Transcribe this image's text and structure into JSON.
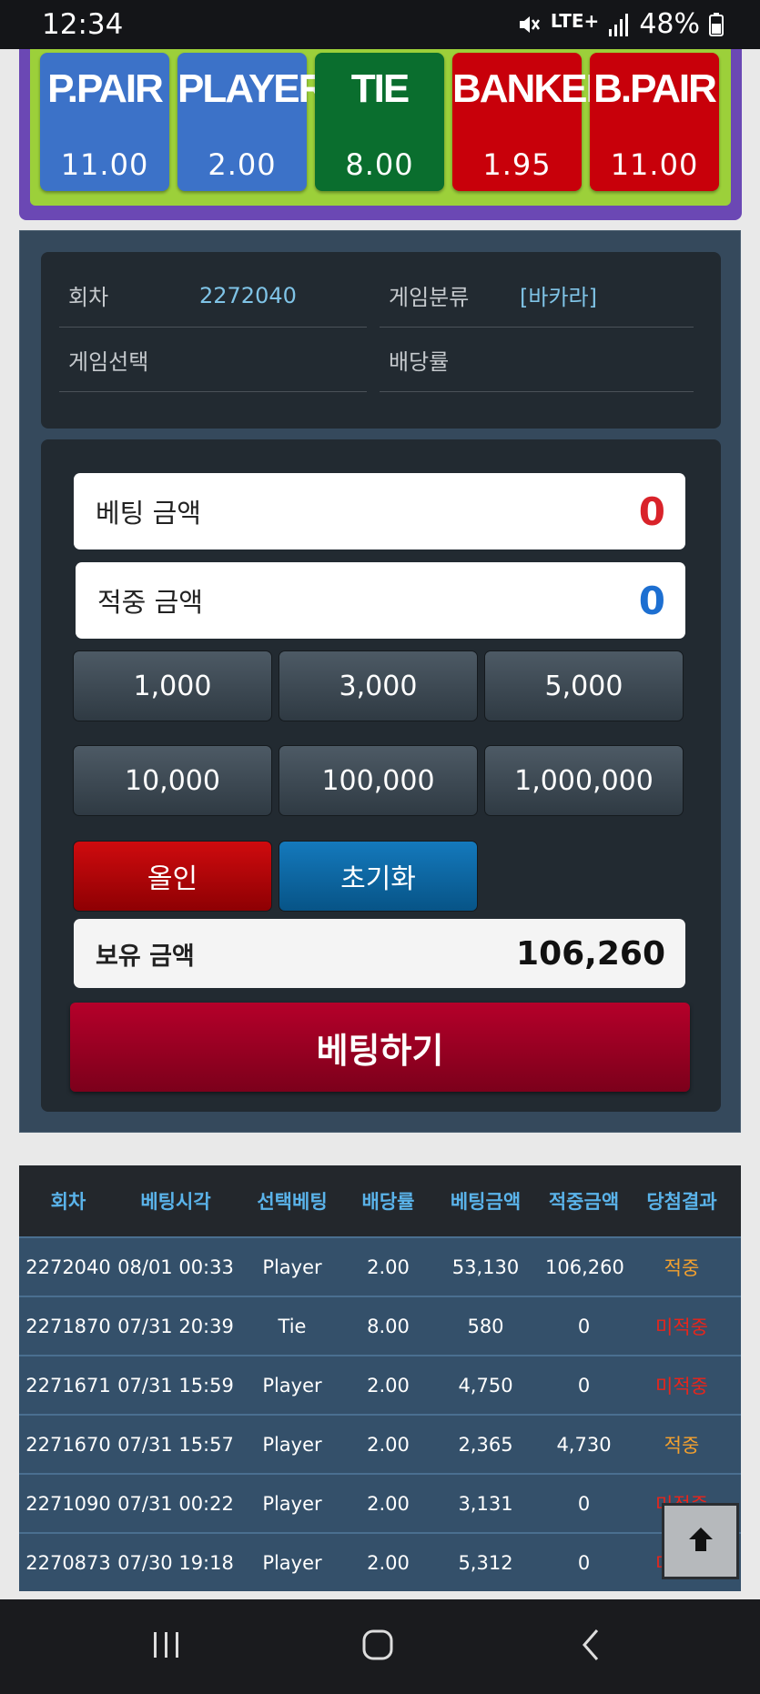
{
  "status_bar": {
    "time": "12:34",
    "network": "LTE+",
    "battery": "48%"
  },
  "bet_options": [
    {
      "name": "P.PAIR",
      "odds": "11.00",
      "color": "#3c72c8"
    },
    {
      "name": "PLAYER",
      "odds": "2.00",
      "color": "#3c72c8"
    },
    {
      "name": "TIE",
      "odds": "8.00",
      "color": "#0a6e2e"
    },
    {
      "name": "BANKER",
      "odds": "1.95",
      "color": "#c8000a"
    },
    {
      "name": "B.PAIR",
      "odds": "11.00",
      "color": "#c8000a"
    }
  ],
  "info": {
    "round_label": "회차",
    "round_value": "2272040",
    "game_type_label": "게임분류",
    "game_type_value": "[바카라]",
    "game_select_label": "게임선택",
    "game_select_value": "",
    "odds_label": "배당률",
    "odds_value": ""
  },
  "bet_form": {
    "bet_amount_label": "베팅 금액",
    "bet_amount_value": "0",
    "win_amount_label": "적중 금액",
    "win_amount_value": "0",
    "chips": [
      "1,000",
      "3,000",
      "5,000",
      "10,000",
      "100,000",
      "1,000,000"
    ],
    "all_in_label": "올인",
    "reset_label": "초기화",
    "balance_label": "보유 금액",
    "balance_value": "106,260",
    "submit_label": "베팅하기"
  },
  "history": {
    "columns": [
      "회차",
      "베팅시각",
      "선택베팅",
      "배당률",
      "베팅금액",
      "적중금액",
      "당첨결과"
    ],
    "rows": [
      [
        "2272040",
        "08/01 00:33",
        "Player",
        "2.00",
        "53,130",
        "106,260",
        "적중"
      ],
      [
        "2271870",
        "07/31 20:39",
        "Tie",
        "8.00",
        "580",
        "0",
        "미적중"
      ],
      [
        "2271671",
        "07/31 15:59",
        "Player",
        "2.00",
        "4,750",
        "0",
        "미적중"
      ],
      [
        "2271670",
        "07/31 15:57",
        "Player",
        "2.00",
        "2,365",
        "4,730",
        "적중"
      ],
      [
        "2271090",
        "07/31 00:22",
        "Player",
        "2.00",
        "3,131",
        "0",
        "미적중"
      ],
      [
        "2270873",
        "07/30 19:18",
        "Player",
        "2.00",
        "5,312",
        "0",
        "미적중"
      ]
    ]
  },
  "icons": {
    "scroll_top": "arrow-up-icon",
    "nav_recent": "recent-apps-icon",
    "nav_home": "home-icon",
    "nav_back": "back-icon"
  },
  "colors": {
    "hit": "#f3a02e",
    "miss": "#e8251b",
    "accent": "#5ab3ea"
  }
}
